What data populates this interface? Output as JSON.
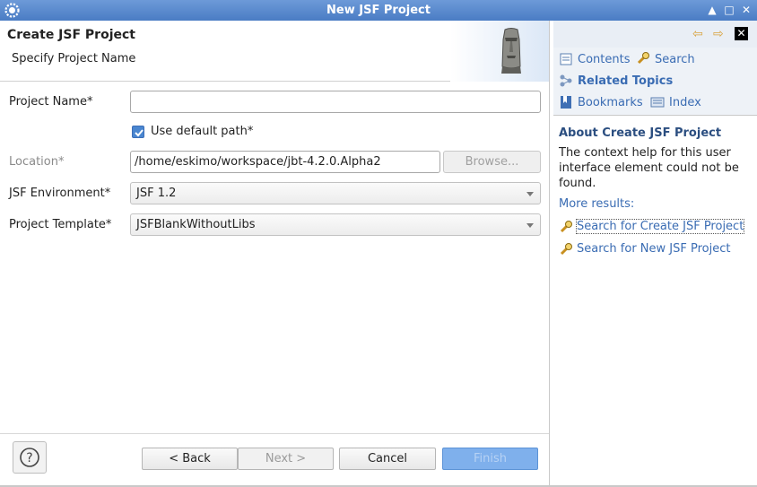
{
  "window": {
    "title": "New JSF Project"
  },
  "header": {
    "title": "Create JSF Project",
    "subtitle": "Specify Project Name"
  },
  "form": {
    "project_name_label": "Project Name*",
    "project_name_value": "",
    "use_default_label": "Use default path*",
    "use_default_checked": true,
    "location_label": "Location*",
    "location_value": "/home/eskimo/workspace/jbt-4.2.0.Alpha2",
    "browse_label": "Browse...",
    "jsf_env_label": "JSF Environment*",
    "jsf_env_value": "JSF 1.2",
    "template_label": "Project Template*",
    "template_value": "JSFBlankWithoutLibs"
  },
  "buttons": {
    "back": "< Back",
    "next": "Next >",
    "cancel": "Cancel",
    "finish": "Finish"
  },
  "help": {
    "tabs": {
      "contents": "Contents",
      "search": "Search",
      "related": "Related Topics",
      "bookmarks": "Bookmarks",
      "index": "Index"
    },
    "about_title": "About Create JSF Project",
    "about_text": "The context help for this user interface element could not be found.",
    "more_results": "More results:",
    "links": [
      "Search for Create JSF Project",
      "Search for New JSF Project"
    ]
  },
  "colors": {
    "titlebar": "#5a88cc",
    "link": "#3a6cb3",
    "finish_button": "#7fb0ec"
  }
}
